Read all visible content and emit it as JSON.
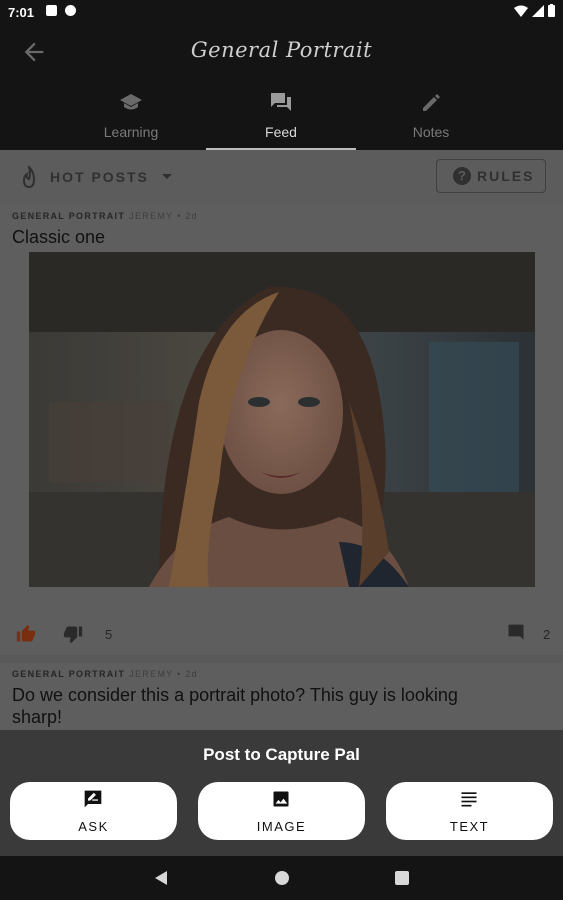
{
  "status_bar": {
    "time": "7:01"
  },
  "app_bar": {
    "title": "General Portrait"
  },
  "tabs": [
    {
      "label": "Learning",
      "icon": "graduation-cap-icon",
      "active": false
    },
    {
      "label": "Feed",
      "icon": "feed-icon",
      "active": true
    },
    {
      "label": "Notes",
      "icon": "pencil-icon",
      "active": false
    }
  ],
  "filter_bar": {
    "sort_label": "HOT POSTS",
    "rules_label": "RULES"
  },
  "posts": [
    {
      "community": "GENERAL PORTRAIT",
      "byline": "JEREMY • 2d",
      "title": "Classic one",
      "score": "5",
      "comments": "2"
    },
    {
      "community": "GENERAL PORTRAIT",
      "byline": "JEREMY • 2d",
      "title": "Do we consider this a portrait photo? This guy is looking sharp!"
    }
  ],
  "sheet": {
    "title": "Post to Capture Pal",
    "ask_label": "ASK",
    "image_label": "IMAGE",
    "text_label": "TEXT"
  },
  "colors": {
    "like_active": "#c2410c",
    "background": "#141414"
  }
}
